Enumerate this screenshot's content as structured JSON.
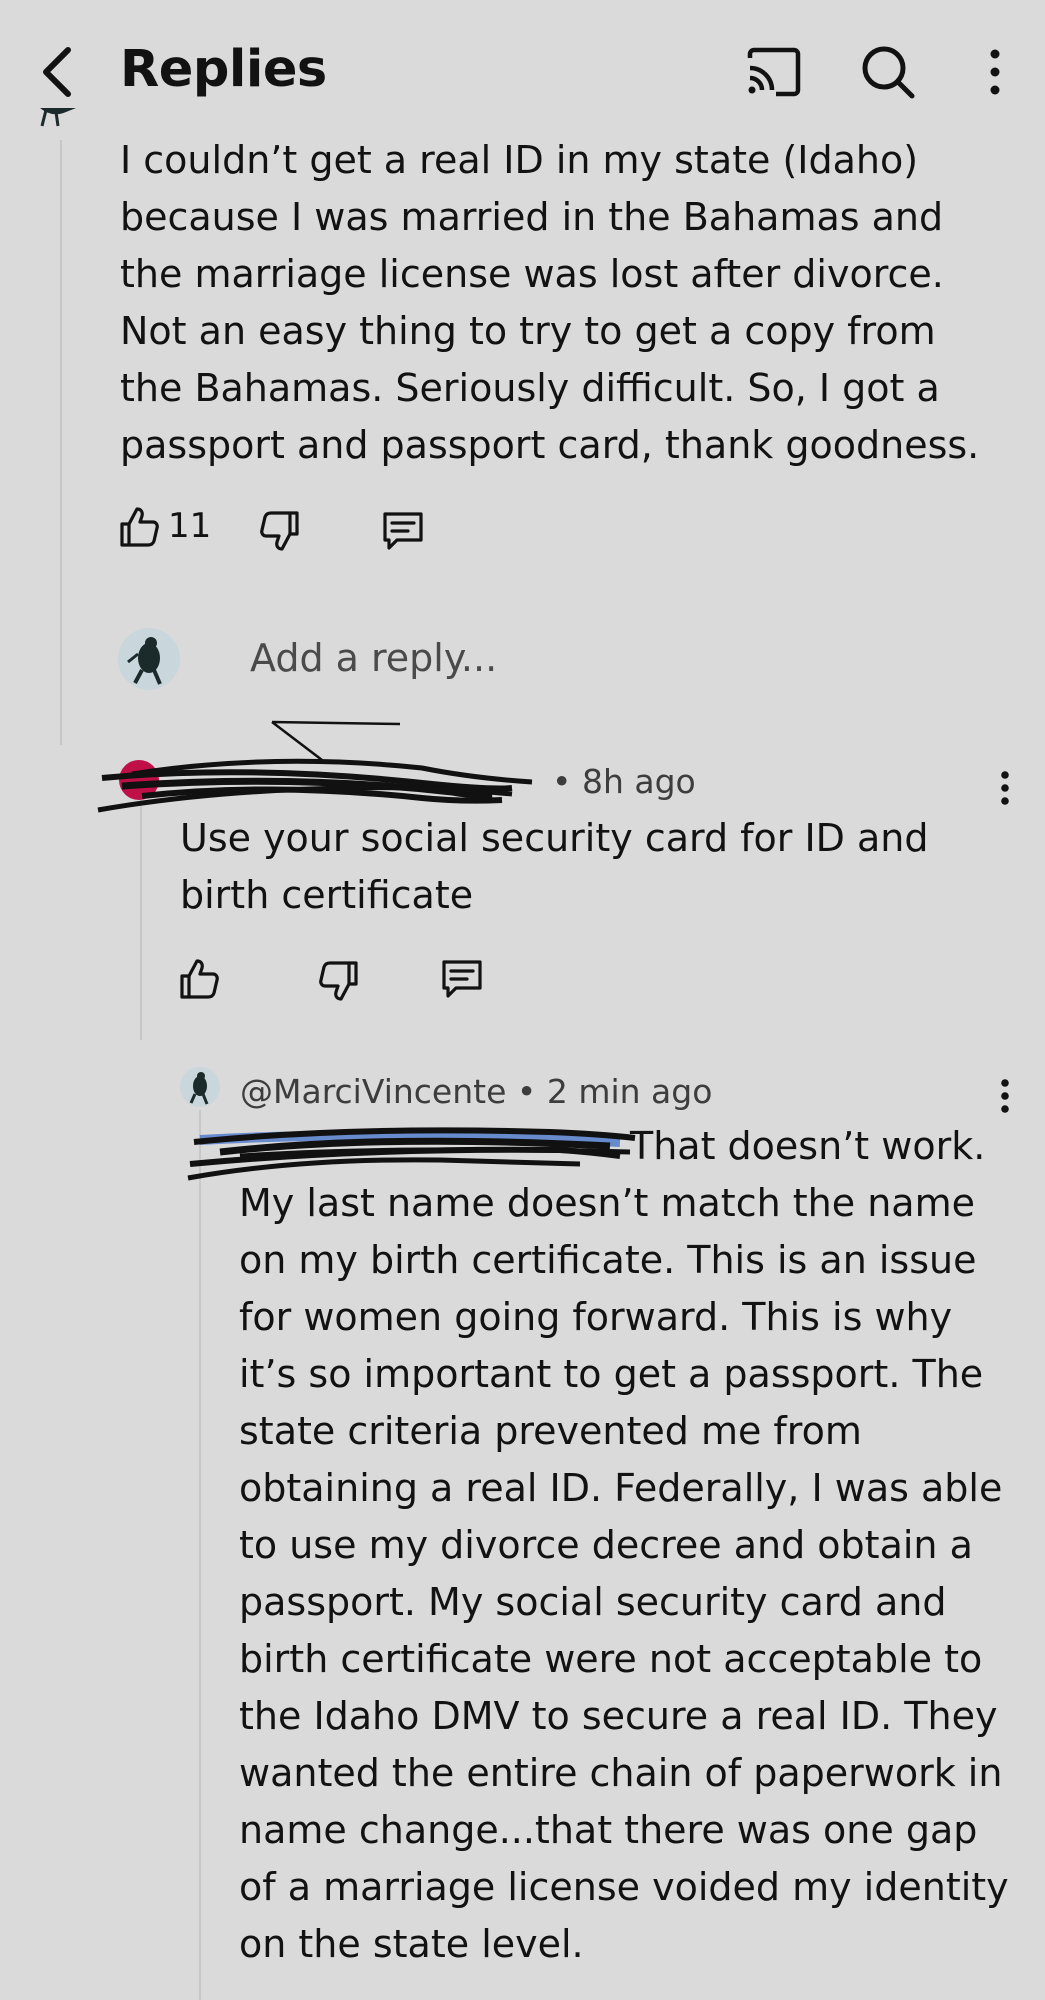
{
  "header": {
    "title": "Replies",
    "back_icon": "chevron-left-icon",
    "cast_icon": "cast-icon",
    "search_icon": "search-icon",
    "more_icon": "more-vertical-icon"
  },
  "comment1": {
    "text": "I couldn’t get a real ID in my state (Idaho) because I was married in the Bahamas and the marriage license was lost after divorce. Not an easy thing to try to get a copy from the Bahamas. Seriously difficult. So, I got a passport and passport card, thank goodness.",
    "likes": "11"
  },
  "reply_box": {
    "placeholder": "Add a reply..."
  },
  "comment2": {
    "time": "• 8h ago",
    "text": "Use your social security card for ID and birth certificate"
  },
  "comment3": {
    "author": "@MarciVincente",
    "time": "• 2 min ago",
    "text": "That doesn’t work. My last name doesn’t match the name on my birth certificate. This is an issue for women going forward. This is why it’s so important to get a passport. The state criteria prevented me from obtaining a real ID. Federally, I was able to use my divorce decree and obtain a passport. My social security card and birth certificate were not acceptable to the Idaho DMV to secure a real ID. They wanted the entire chain of paperwork in name change...that there was one gap of a marriage license voided my identity on the state level."
  },
  "colors": {
    "background": "#dadada",
    "text": "#121212",
    "avatar_red": "#c01048",
    "mention_blue": "#1a56c4"
  }
}
